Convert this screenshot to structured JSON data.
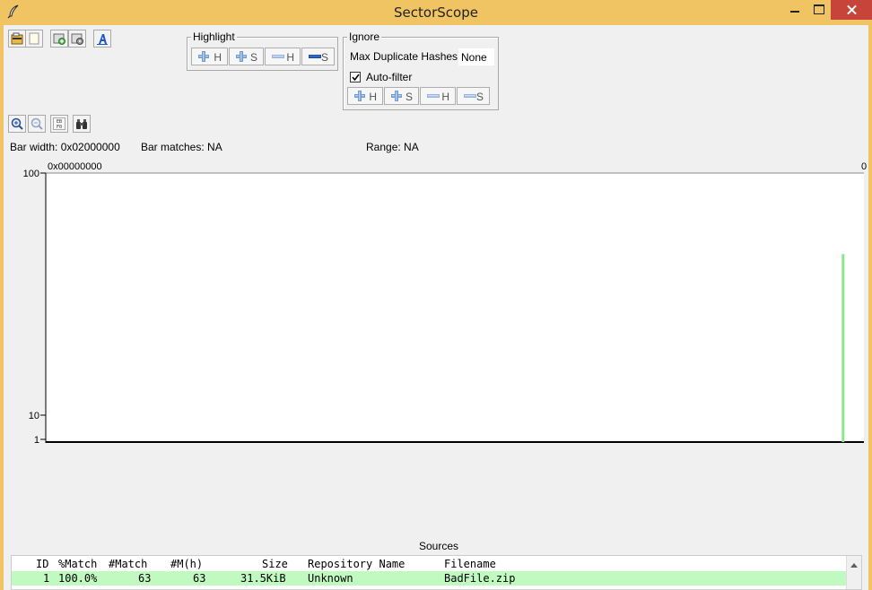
{
  "window": {
    "title": "SectorScope",
    "app_icon": "feather-icon"
  },
  "toolbar_top": [
    {
      "name": "open-file-icon"
    },
    {
      "name": "new-file-icon"
    },
    {
      "name": "add-disk-icon"
    },
    {
      "name": "settings-disk-icon"
    },
    {
      "name": "font-icon"
    }
  ],
  "highlight": {
    "legend": "Highlight",
    "buttons": [
      {
        "icon": "plus-icon",
        "label": "H"
      },
      {
        "icon": "plus-icon",
        "label": "S"
      },
      {
        "icon": "minus-icon",
        "label": "H"
      },
      {
        "icon": "minus-icon",
        "label": "S"
      }
    ]
  },
  "ignore": {
    "legend": "Ignore",
    "max_dup_label": "Max Duplicate Hashes:",
    "max_dup_value": "None",
    "autofilter_label": "Auto-filter",
    "autofilter_checked": true,
    "buttons": [
      {
        "icon": "plus-icon",
        "label": "H"
      },
      {
        "icon": "plus-icon",
        "label": "S"
      },
      {
        "icon": "minus-icon",
        "label": "H"
      },
      {
        "icon": "minus-icon",
        "label": "S"
      }
    ]
  },
  "toolbar_nav": [
    {
      "name": "zoom-in-icon"
    },
    {
      "name": "zoom-out-icon"
    },
    {
      "name": "hex-view-icon",
      "text": "EB F0"
    },
    {
      "name": "binoculars-icon"
    }
  ],
  "info": {
    "bar_width": "Bar width: 0x02000000",
    "bar_matches": "Bar matches: NA",
    "range": "Range: NA"
  },
  "chart_data": {
    "type": "bar",
    "x_start_label": "0x00000000",
    "x_end_label": "0",
    "y_scale": "log",
    "y_ticks": [
      "100",
      "10",
      "1"
    ],
    "ylim": [
      1,
      100
    ],
    "bars": [
      {
        "position_fraction": 0.974,
        "value": 25,
        "color": "#8ae88a"
      }
    ],
    "grid": false
  },
  "sources": {
    "label": "Sources",
    "columns": [
      "ID",
      "%Match",
      "#Match",
      "#M(h)",
      "Size",
      "Repository Name",
      "Filename"
    ],
    "rows": [
      {
        "id": "1",
        "pct_match": "100.0%",
        "match": "63",
        "mh": "63",
        "size": "31.5KiB",
        "repo": "Unknown",
        "filename": "BadFile.zip"
      }
    ],
    "row_color": "#c1fac1"
  }
}
